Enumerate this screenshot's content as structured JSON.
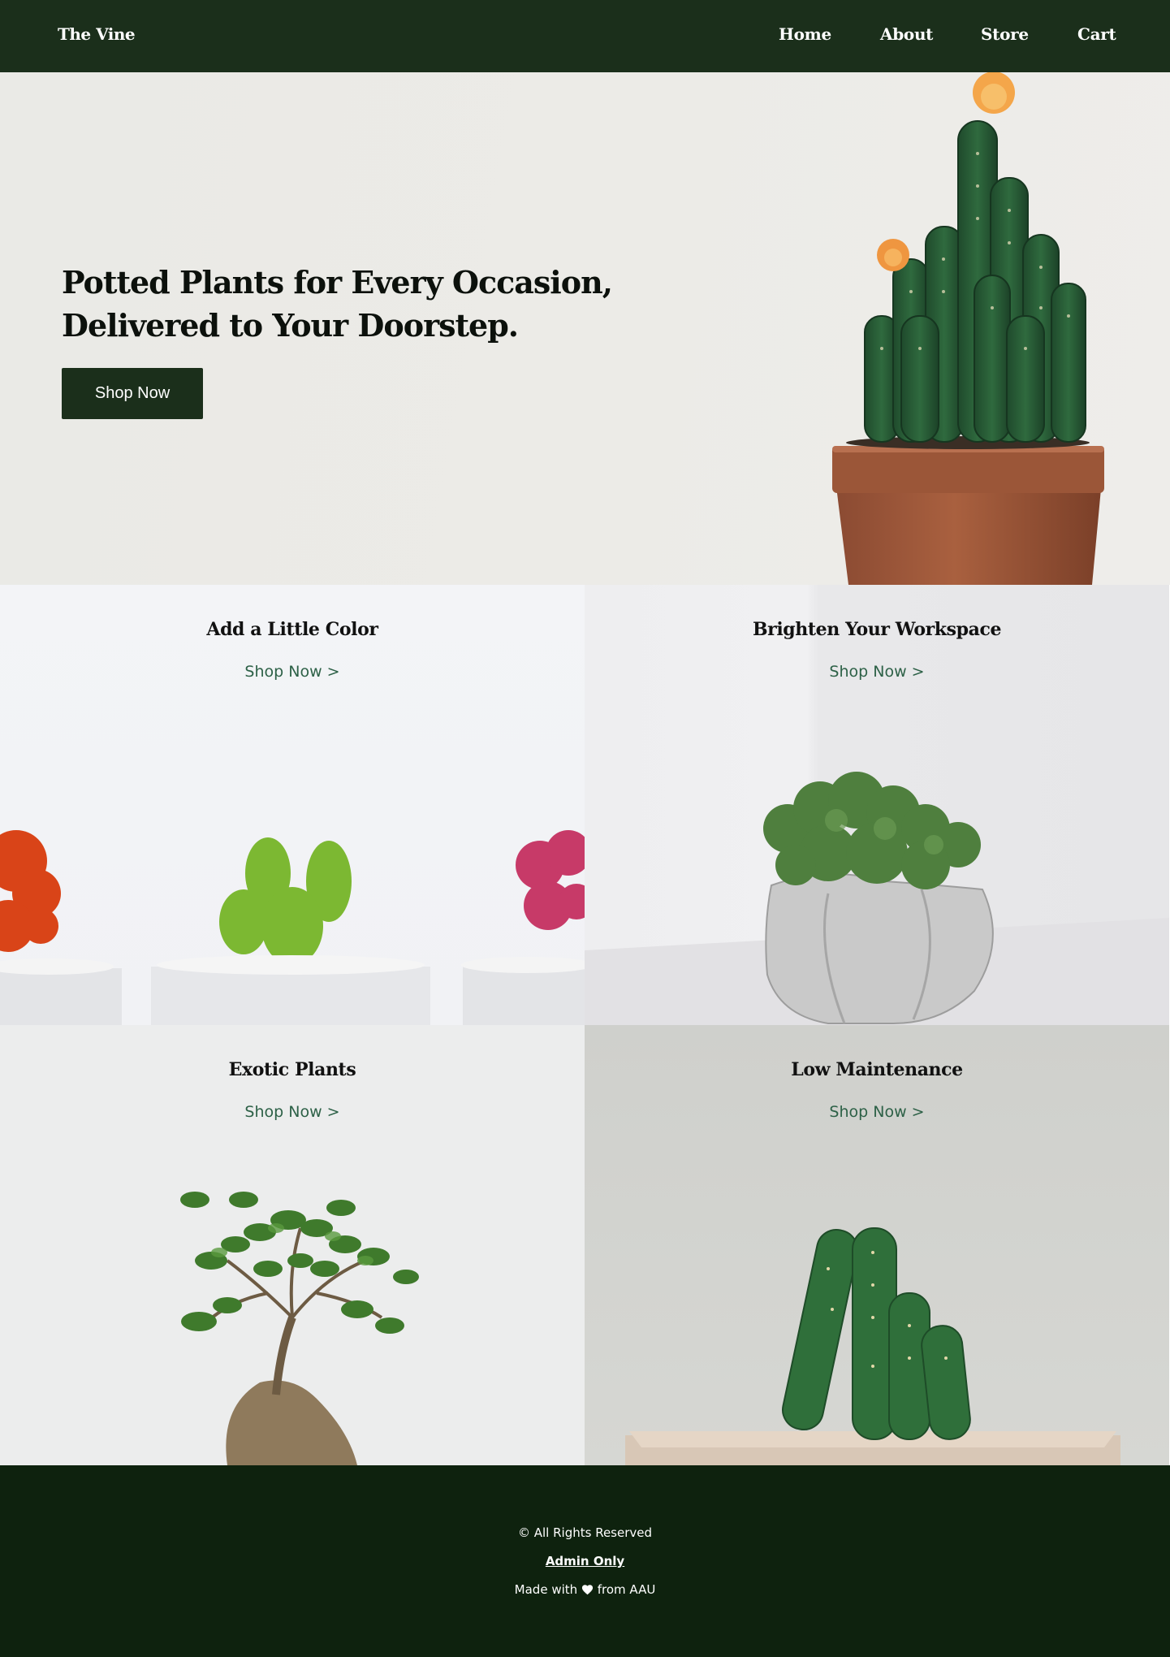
{
  "nav": {
    "brand": "The Vine",
    "links": [
      "Home",
      "About",
      "Store",
      "Cart"
    ]
  },
  "hero": {
    "title_line1": "Potted Plants for Every Occasion,",
    "title_line2": "Delivered to Your Doorstep.",
    "cta": "Shop Now",
    "image": "cactus-in-terracotta-pot-with-orange-flowers"
  },
  "tiles": [
    {
      "title": "Add a Little Color",
      "link": "Shop Now >",
      "image": "colorful-cacti-in-white-pots"
    },
    {
      "title": "Brighten Your Workspace",
      "link": "Shop Now >",
      "image": "moss-in-concrete-pot"
    },
    {
      "title": "Exotic Plants",
      "link": "Shop Now >",
      "image": "bonsai-ficus"
    },
    {
      "title": "Low Maintenance",
      "link": "Shop Now >",
      "image": "cactus-in-square-planter"
    }
  ],
  "footer": {
    "copyright": "© All Rights Reserved",
    "admin": "Admin Only",
    "made_prefix": "Made with",
    "made_suffix": "from AAU",
    "heart_icon": "heart-icon"
  },
  "colors": {
    "nav_bg": "#1b2f1b",
    "footer_bg": "#0e220e",
    "link_green": "#2d6147"
  }
}
